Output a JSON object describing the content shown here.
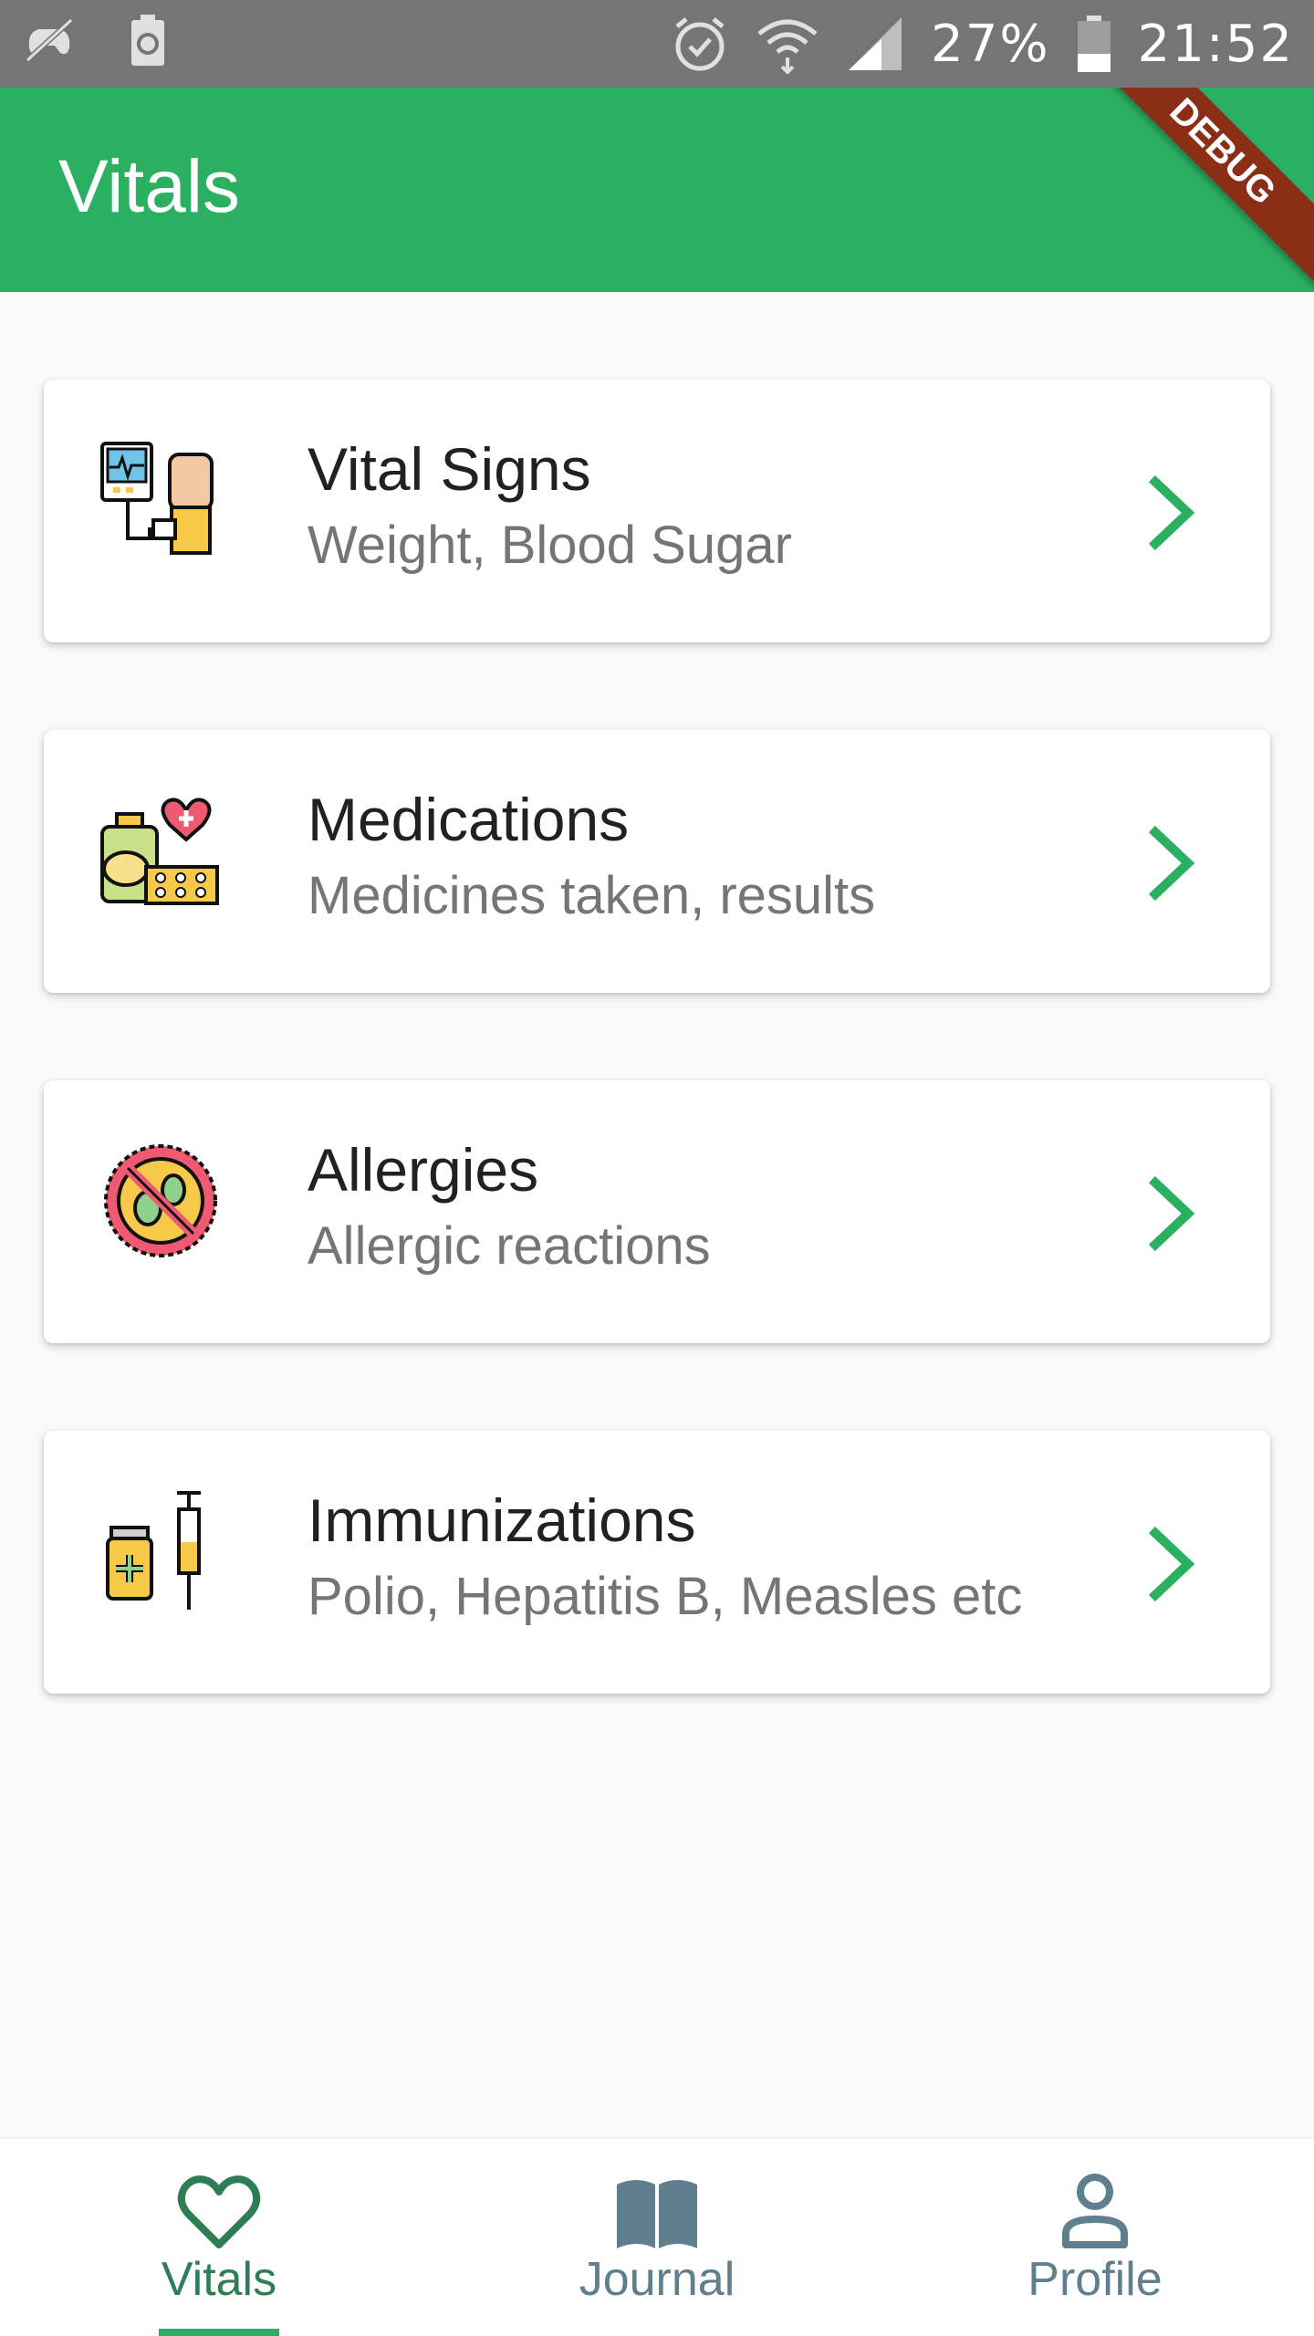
{
  "status_bar": {
    "battery": "27%",
    "time": "21:52"
  },
  "app_bar": {
    "title": "Vitals",
    "debug_banner": "DEBUG"
  },
  "cards": [
    {
      "title": "Vital Signs",
      "subtitle": "Weight, Blood Sugar",
      "icon": "vital-signs-monitor-icon"
    },
    {
      "title": "Medications",
      "subtitle": "Medicines taken, results",
      "icon": "medications-pills-icon"
    },
    {
      "title": "Allergies",
      "subtitle": "Allergic reactions",
      "icon": "allergy-germ-icon"
    },
    {
      "title": "Immunizations",
      "subtitle": "Polio, Hepatitis B, Measles etc",
      "icon": "vaccine-syringe-icon"
    }
  ],
  "bottom_nav": {
    "items": [
      {
        "label": "Vitals",
        "icon": "heart-icon",
        "active": true
      },
      {
        "label": "Journal",
        "icon": "book-icon",
        "active": false
      },
      {
        "label": "Profile",
        "icon": "person-icon",
        "active": false
      }
    ]
  },
  "colors": {
    "primary": "#2bb062",
    "active_nav": "#2e7d55",
    "inactive_nav": "#5f7f8e",
    "status_bar": "#757575"
  }
}
